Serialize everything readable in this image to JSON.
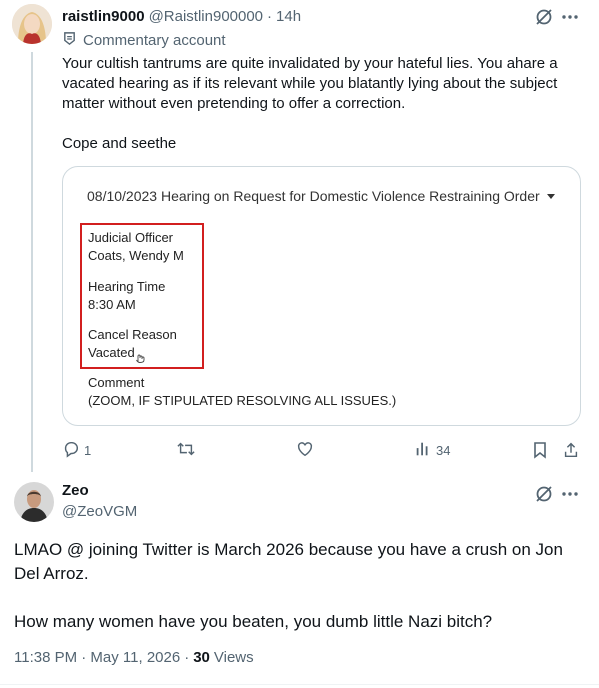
{
  "reply": {
    "display_name": "raistlin9000",
    "handle": "@Raistlin900000",
    "separator": "·",
    "time": "14h",
    "label_text": "Commentary account",
    "text": "Your cultish tantrums are quite invalidated by your hateful lies. You ahare a vacated hearing as if its relevant while you blatantly lying about the subject matter without even pretending to offer a correction.\n\nCope and seethe",
    "card": {
      "header": "08/10/2023 Hearing on Request for Domestic Violence Restraining Order",
      "judicial_officer_label": "Judicial Officer",
      "judicial_officer_value": "Coats, Wendy M",
      "hearing_time_label": "Hearing Time",
      "hearing_time_value": "8:30 AM",
      "cancel_reason_label": "Cancel Reason",
      "cancel_reason_value": "Vacated",
      "comment_label": "Comment",
      "comment_value": "(ZOOM, IF STIPULATED RESOLVING ALL ISSUES.)"
    },
    "actions": {
      "replies": "1",
      "retweets": "",
      "likes": "",
      "views": "34"
    }
  },
  "main": {
    "display_name": "Zeo",
    "handle": "@ZeoVGM",
    "text": "LMAO @ joining Twitter is March 2026 because you have a crush on Jon Del Arroz.\n\nHow many women have you beaten, you dumb little Nazi bitch?",
    "timestamp": "11:38 PM · May 11, 2026",
    "separator": "·",
    "views_count": "30",
    "views_label": "Views"
  },
  "icons": {
    "grok": "grok-icon",
    "more": "more-icon",
    "reply": "reply-icon",
    "retweet": "retweet-icon",
    "like": "like-icon",
    "views": "views-icon",
    "bookmark": "bookmark-icon",
    "share": "share-icon",
    "commentary": "commentary-icon"
  },
  "colors": {
    "text": "#0f1419",
    "secondary": "#536471",
    "border": "#cfd9de",
    "highlight_box": "#d21f1f"
  }
}
